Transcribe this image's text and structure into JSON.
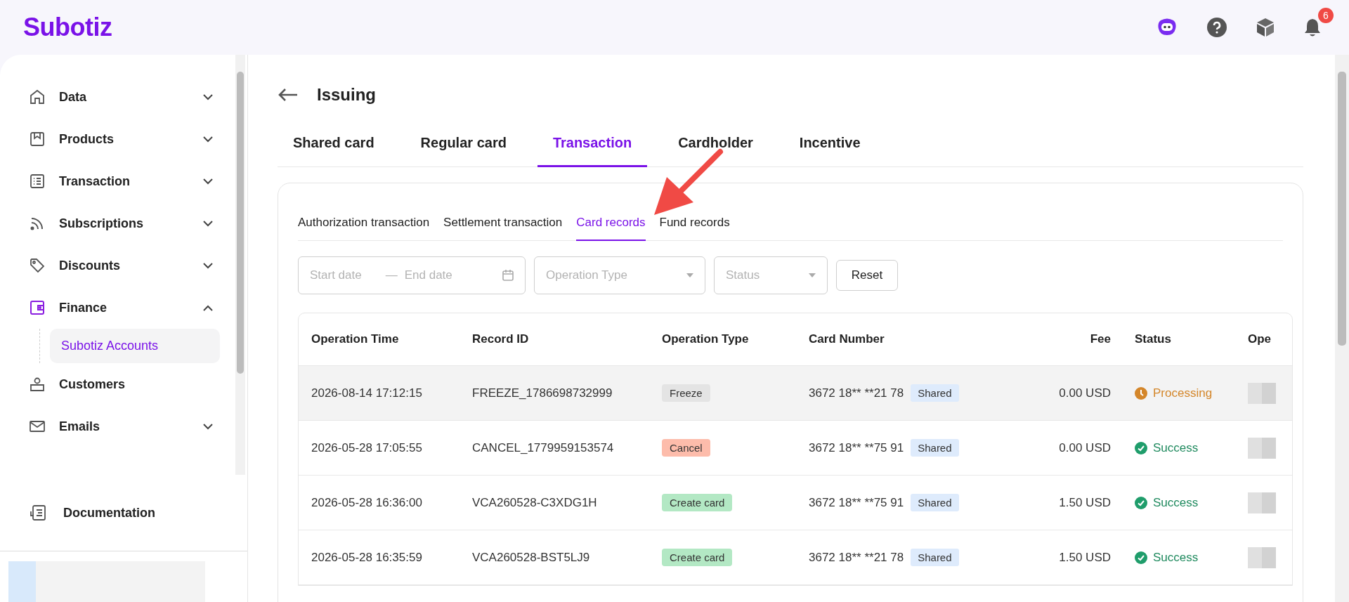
{
  "header": {
    "logo": "Subotiz",
    "notification_count": "6"
  },
  "sidebar": {
    "items": [
      {
        "label": "Data",
        "kind": "group",
        "expanded": false
      },
      {
        "label": "Products",
        "kind": "group",
        "expanded": false
      },
      {
        "label": "Transaction",
        "kind": "group",
        "expanded": false
      },
      {
        "label": "Subscriptions",
        "kind": "group",
        "expanded": false
      },
      {
        "label": "Discounts",
        "kind": "group",
        "expanded": false
      },
      {
        "label": "Finance",
        "kind": "group",
        "expanded": true,
        "children": [
          {
            "label": "Subotiz Accounts",
            "selected": true
          }
        ]
      },
      {
        "label": "Customers",
        "kind": "link"
      },
      {
        "label": "Emails",
        "kind": "group",
        "expanded": false
      }
    ],
    "footer_item": "Documentation"
  },
  "page": {
    "title": "Issuing",
    "tabs": [
      {
        "label": "Shared card",
        "selected": false
      },
      {
        "label": "Regular card",
        "selected": false
      },
      {
        "label": "Transaction",
        "selected": true
      },
      {
        "label": "Cardholder",
        "selected": false
      },
      {
        "label": "Incentive",
        "selected": false
      }
    ],
    "subtabs": [
      {
        "label": "Authorization transaction",
        "selected": false
      },
      {
        "label": "Settlement transaction",
        "selected": false
      },
      {
        "label": "Card records",
        "selected": true
      },
      {
        "label": "Fund records",
        "selected": false
      }
    ],
    "filters": {
      "start_placeholder": "Start date",
      "separator": "—",
      "end_placeholder": "End date",
      "operation_type_placeholder": "Operation Type",
      "status_placeholder": "Status",
      "reset_label": "Reset"
    },
    "table": {
      "columns": [
        "Operation Time",
        "Record ID",
        "Operation Type",
        "Card Number",
        "Fee",
        "Status",
        "Ope"
      ],
      "rows": [
        {
          "time": "2026-08-14 17:12:15",
          "record_id": "FREEZE_1786698732999",
          "operation_type": {
            "label": "Freeze",
            "kind": "freeze"
          },
          "card_number": "3672 18** **21 78",
          "card_tag": "Shared",
          "fee": "0.00 USD",
          "status": {
            "label": "Processing",
            "kind": "processing"
          },
          "highlighted": true
        },
        {
          "time": "2026-05-28 17:05:55",
          "record_id": "CANCEL_1779959153574",
          "operation_type": {
            "label": "Cancel",
            "kind": "cancel"
          },
          "card_number": "3672 18** **75 91",
          "card_tag": "Shared",
          "fee": "0.00 USD",
          "status": {
            "label": "Success",
            "kind": "success"
          },
          "highlighted": false
        },
        {
          "time": "2026-05-28 16:36:00",
          "record_id": "VCA260528-C3XDG1H",
          "operation_type": {
            "label": "Create card",
            "kind": "create"
          },
          "card_number": "3672 18** **75 91",
          "card_tag": "Shared",
          "fee": "1.50 USD",
          "status": {
            "label": "Success",
            "kind": "success"
          },
          "highlighted": false
        },
        {
          "time": "2026-05-28 16:35:59",
          "record_id": "VCA260528-BST5LJ9",
          "operation_type": {
            "label": "Create card",
            "kind": "create"
          },
          "card_number": "3672 18** **21 78",
          "card_tag": "Shared",
          "fee": "1.50 USD",
          "status": {
            "label": "Success",
            "kind": "success"
          },
          "highlighted": false
        }
      ]
    }
  }
}
